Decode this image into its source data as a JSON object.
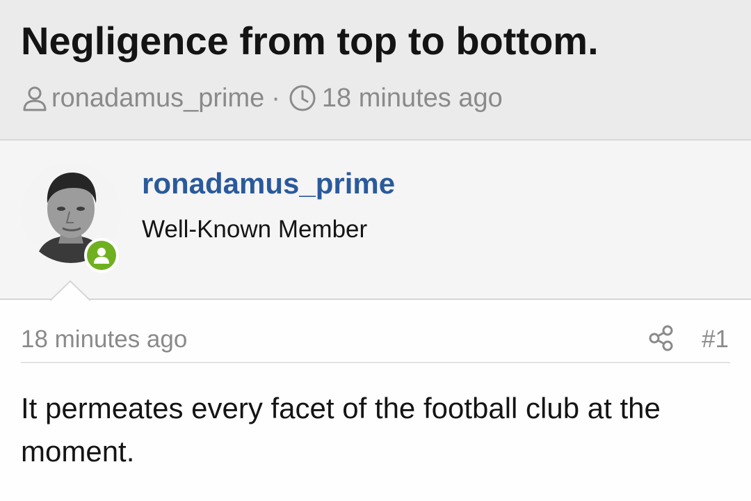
{
  "thread": {
    "title": "Negligence from top to bottom.",
    "author": "ronadamus_prime",
    "separator": "·",
    "time_ago": "18 minutes ago",
    "author_icon": "user-icon",
    "time_icon": "clock-icon"
  },
  "post": {
    "username": "ronadamus_prime",
    "user_title": "Well-Known Member",
    "avatar": "avatar",
    "online_status_icon": "online-user-icon",
    "date": "18 minutes ago",
    "share_icon": "share-icon",
    "number": "#1",
    "body": "It permeates every facet of the football club at the moment."
  },
  "colors": {
    "header_bg": "#ebebeb",
    "user_block_bg": "#f5f5f5",
    "username": "#2a5a9c",
    "online": "#6fb01e",
    "muted_text": "#8a8a8a"
  }
}
